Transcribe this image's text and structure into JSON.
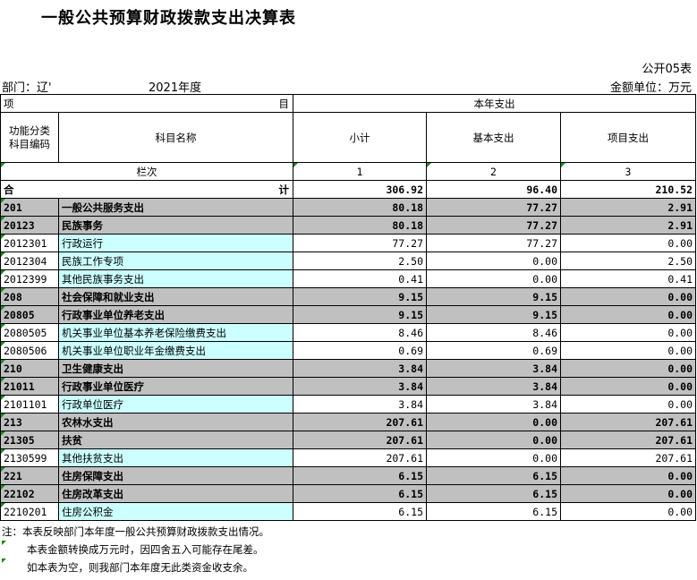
{
  "title": "一般公共预算财政拨款支出决算表",
  "form_code": "公开05表",
  "department": "部门：辽'",
  "year": "2021年度",
  "unit": "金额单位：万元",
  "header": {
    "item": "项",
    "item2": "目",
    "current_year": "本年支出",
    "func_code": "功能分类",
    "func_code2": "科目编码",
    "subject_name": "科目名称",
    "subtotal": "小计",
    "basic": "基本支出",
    "project": "项目支出",
    "column_no": "栏次",
    "col1": "1",
    "col2": "2",
    "col3": "3"
  },
  "total": {
    "label1": "合",
    "label2": "计",
    "subtotal": "306.92",
    "basic": "96.40",
    "project": "210.52"
  },
  "rows": [
    {
      "code": "201",
      "name": "一般公共服务支出",
      "subtotal": "80.18",
      "basic": "77.27",
      "project": "2.91",
      "level": "class"
    },
    {
      "code": "20123",
      "name": "民族事务",
      "subtotal": "80.18",
      "basic": "77.27",
      "project": "2.91",
      "level": "class"
    },
    {
      "code": "2012301",
      "name": "行政运行",
      "subtotal": "77.27",
      "basic": "77.27",
      "project": "0.00",
      "level": "item"
    },
    {
      "code": "2012304",
      "name": "民族工作专项",
      "subtotal": "2.50",
      "basic": "0.00",
      "project": "2.50",
      "level": "item"
    },
    {
      "code": "2012399",
      "name": "其他民族事务支出",
      "subtotal": "0.41",
      "basic": "0.00",
      "project": "0.41",
      "level": "item"
    },
    {
      "code": "208",
      "name": "社会保障和就业支出",
      "subtotal": "9.15",
      "basic": "9.15",
      "project": "0.00",
      "level": "class"
    },
    {
      "code": "20805",
      "name": "行政事业单位养老支出",
      "subtotal": "9.15",
      "basic": "9.15",
      "project": "0.00",
      "level": "class"
    },
    {
      "code": "2080505",
      "name": "机关事业单位基本养老保险缴费支出",
      "subtotal": "8.46",
      "basic": "8.46",
      "project": "0.00",
      "level": "item"
    },
    {
      "code": "2080506",
      "name": "机关事业单位职业年金缴费支出",
      "subtotal": "0.69",
      "basic": "0.69",
      "project": "0.00",
      "level": "item"
    },
    {
      "code": "210",
      "name": "卫生健康支出",
      "subtotal": "3.84",
      "basic": "3.84",
      "project": "0.00",
      "level": "class"
    },
    {
      "code": "21011",
      "name": "行政事业单位医疗",
      "subtotal": "3.84",
      "basic": "3.84",
      "project": "0.00",
      "level": "class"
    },
    {
      "code": "2101101",
      "name": "行政单位医疗",
      "subtotal": "3.84",
      "basic": "3.84",
      "project": "0.00",
      "level": "item"
    },
    {
      "code": "213",
      "name": "农林水支出",
      "subtotal": "207.61",
      "basic": "0.00",
      "project": "207.61",
      "level": "class"
    },
    {
      "code": "21305",
      "name": "扶贫",
      "subtotal": "207.61",
      "basic": "0.00",
      "project": "207.61",
      "level": "class"
    },
    {
      "code": "2130599",
      "name": "其他扶贫支出",
      "subtotal": "207.61",
      "basic": "0.00",
      "project": "207.61",
      "level": "item"
    },
    {
      "code": "221",
      "name": "住房保障支出",
      "subtotal": "6.15",
      "basic": "6.15",
      "project": "0.00",
      "level": "class"
    },
    {
      "code": "22102",
      "name": "住房改革支出",
      "subtotal": "6.15",
      "basic": "6.15",
      "project": "0.00",
      "level": "class"
    },
    {
      "code": "2210201",
      "name": "住房公积金",
      "subtotal": "6.15",
      "basic": "6.15",
      "project": "0.00",
      "level": "item"
    }
  ],
  "notes": [
    "注：本表反映部门本年度一般公共预算财政拨款支出情况。",
    "本表金额转换成万元时，因四舍五入可能存在尾差。",
    "如本表为空，则我部门本年度无此类资金收支余。"
  ],
  "colors": {
    "grey": "#c0c0c0",
    "cyan": "#ccffff",
    "marker": "#1a8a1a"
  }
}
